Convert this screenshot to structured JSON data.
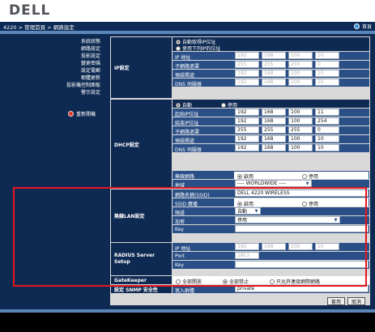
{
  "header": {
    "logo": "DELL",
    "breadcrumb": "4220 > 管理首頁 > 網路設定",
    "home_label": "首頁"
  },
  "sidebar": {
    "items": [
      {
        "label": "系統狀態"
      },
      {
        "label": "網路設定"
      },
      {
        "label": "投影設定"
      },
      {
        "label": "變更密碼"
      },
      {
        "label": "設定電郵"
      },
      {
        "label": "韌體更新"
      },
      {
        "label": "投影機控制面板"
      },
      {
        "label": "警示設定"
      }
    ],
    "restart_label": "重新開機"
  },
  "ip": {
    "section": "IP設定",
    "auto": "自動取得IP位址",
    "manual": "使用下列IP的位址",
    "fields": [
      {
        "label": "IP 地址",
        "v": [
          "192",
          "168",
          "100",
          "10"
        ]
      },
      {
        "label": "子網路遮罩",
        "v": [
          "255",
          "255",
          "255",
          "0"
        ]
      },
      {
        "label": "預設閘道",
        "v": [
          "192",
          "168",
          "100",
          "10"
        ]
      },
      {
        "label": "DNS 伺服器",
        "v": [
          "192",
          "168",
          "100",
          "10"
        ]
      }
    ]
  },
  "dhcp": {
    "section": "DHCP設定",
    "auto": "自動",
    "disable": "停用",
    "fields": [
      {
        "label": "起始IP位址",
        "v": [
          "192",
          "168",
          "100",
          "11"
        ]
      },
      {
        "label": "結束IP位址",
        "v": [
          "192",
          "168",
          "100",
          "254"
        ]
      },
      {
        "label": "子網路遮罩",
        "v": [
          "255",
          "255",
          "255",
          "0"
        ]
      },
      {
        "label": "預設閘道",
        "v": [
          "192",
          "168",
          "100",
          "10"
        ]
      },
      {
        "label": "DNS 伺服器",
        "v": [
          "192",
          "168",
          "100",
          "10"
        ]
      }
    ],
    "wireless_label": "無線網路",
    "enable": "啟用",
    "disable2": "停用",
    "region_label": "地域",
    "region_value": "---- WORLDWIDE ----"
  },
  "wlan": {
    "section": "無線LAN設定",
    "ssid_name_label": "網路名稱(SSID)",
    "ssid_name_value": "DELL 4220 WIRELESS",
    "ssid_broadcast_label": "SSID 廣播",
    "enable": "啟用",
    "disable": "停用",
    "channel_label": "頻道",
    "channel_value": "自動",
    "encrypt_label": "加密",
    "encrypt_value": "停用",
    "key_label": "Key"
  },
  "radius": {
    "section": "RADIUS Server Setup",
    "ip_label": "IP 地址",
    "ip": [
      "192",
      "168",
      "100",
      "10"
    ],
    "port_label": "Port",
    "port_value": "1812",
    "key_label": "Key"
  },
  "gatekeeper": {
    "section": "GateKeeper",
    "opt1": "全部開放",
    "opt2": "全部禁止",
    "opt3": "只允許連接網際網路"
  },
  "snmp": {
    "section": "設定 SNMP 安全性",
    "label": "寫入群體",
    "value": "private"
  },
  "buttons": {
    "apply": "套用",
    "cancel": "取消"
  }
}
